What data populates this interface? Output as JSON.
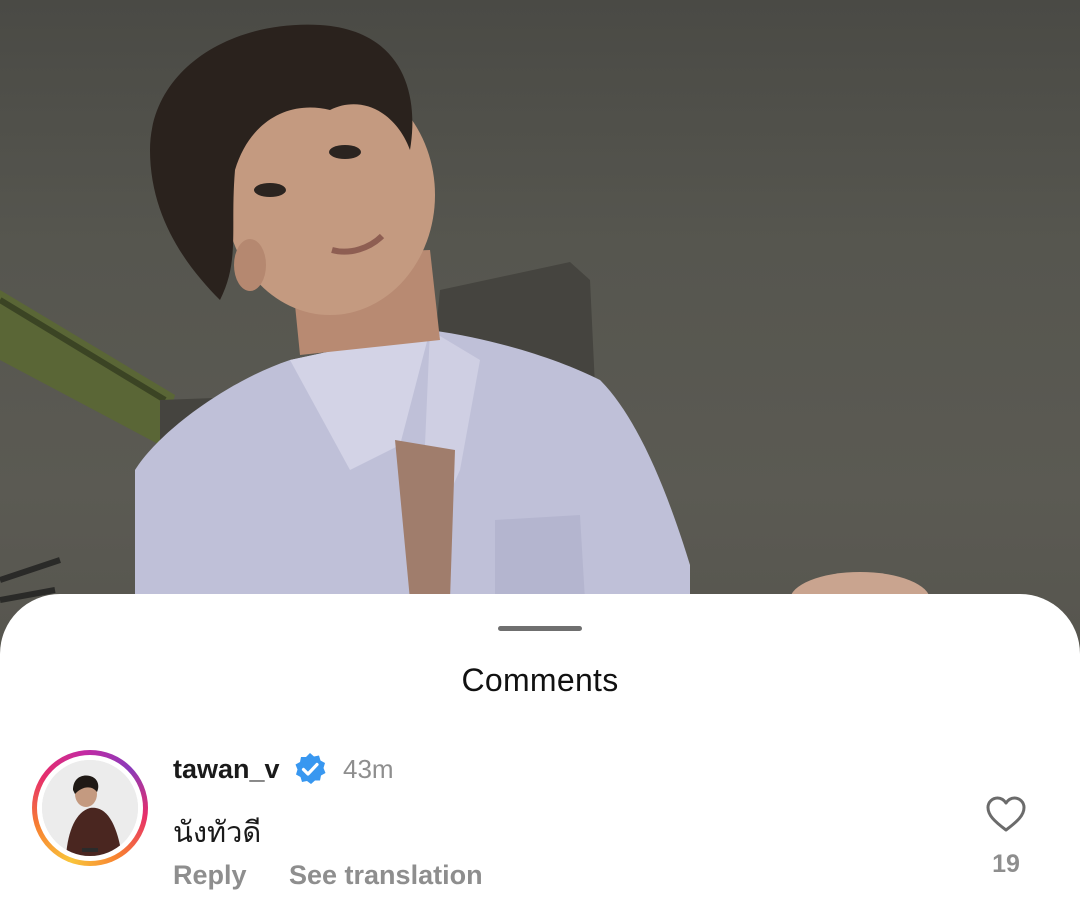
{
  "colors": {
    "sheet_background": "#ffffff",
    "primary_text": "#1a1a1a",
    "secondary_text": "#8e8e8e",
    "verified_badge": "#3897f0",
    "avatar_ring_start": "#f9c53b",
    "avatar_ring_end": "#c32aa3"
  },
  "background": {
    "photo_icon": "portrait-photo"
  },
  "sheet": {
    "title": "Comments"
  },
  "comment": {
    "username": "tawan_v",
    "verified_icon": "verified-badge-icon",
    "timestamp": "43m",
    "text": "นังทัวดี",
    "reply_label": "Reply",
    "translate_label": "See translation",
    "like_icon": "heart-outline-icon",
    "like_count": "19"
  }
}
